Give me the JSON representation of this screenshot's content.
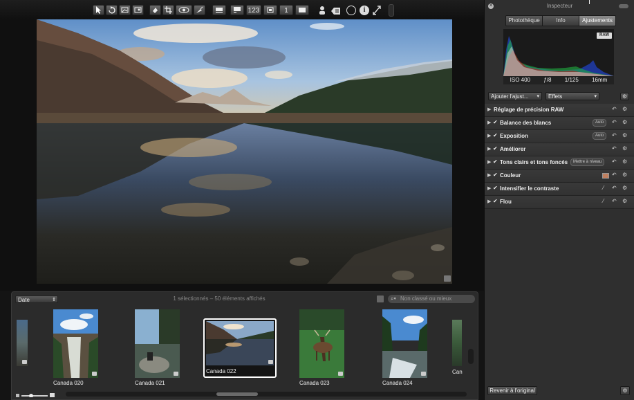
{
  "toolbar": {
    "tools": [
      {
        "icon": "pointer-icon"
      },
      {
        "icon": "rotate-icon"
      },
      {
        "icon": "straighten-icon"
      },
      {
        "icon": "crop-overlay-icon"
      },
      {
        "icon": "lift-icon"
      },
      {
        "icon": "crop-icon"
      },
      {
        "icon": "redeye-icon"
      },
      {
        "icon": "brush-icon"
      }
    ],
    "views": [
      {
        "icon": "filmstrip-view-icon"
      },
      {
        "icon": "split-view-icon"
      },
      {
        "icon": "grid-view-icon"
      },
      {
        "icon": "viewer-icon"
      },
      {
        "icon": "compare-icon"
      },
      {
        "icon": "fullscreen-icon"
      }
    ],
    "view_labels": [
      "",
      "",
      "123",
      "",
      "1",
      ""
    ],
    "right_icons": [
      "person-icon",
      "tag-icon",
      "circle-icon",
      "info-icon",
      "expand-icon",
      "toggle-icon"
    ]
  },
  "browser": {
    "sort_value": "Date",
    "status": "1 sélectionnés – 50 éléments affichés",
    "filter_placeholder": "Non classé ou mieux",
    "thumbs": [
      {
        "caption": "",
        "selected": false,
        "scene": "partial-left"
      },
      {
        "caption": "Canada 020",
        "selected": false,
        "scene": "waterfall"
      },
      {
        "caption": "Canada 021",
        "selected": false,
        "scene": "rocks"
      },
      {
        "caption": "Canada 022",
        "selected": true,
        "scene": "lake"
      },
      {
        "caption": "Canada 023",
        "selected": false,
        "scene": "elk"
      },
      {
        "caption": "Canada 024",
        "selected": false,
        "scene": "stream"
      },
      {
        "caption": "Can",
        "selected": false,
        "scene": "partial-right"
      }
    ]
  },
  "inspector": {
    "title": "Inspecteur",
    "tabs": [
      "Photothèque",
      "Info",
      "Ajustements"
    ],
    "active_tab": "Ajustements",
    "raw_badge": "RAW",
    "exif": [
      "ISO 400",
      "ƒ/8",
      "1/125",
      "16mm"
    ],
    "add_adjustment": "Ajouter l'ajust...",
    "effects": "Effets",
    "adjustments": [
      {
        "label": "Réglage de précision RAW",
        "checked": false,
        "pill": "",
        "tool": ""
      },
      {
        "label": "Balance des blancs",
        "checked": true,
        "pill": "Auto",
        "tool": ""
      },
      {
        "label": "Exposition",
        "checked": true,
        "pill": "Auto",
        "tool": ""
      },
      {
        "label": "Améliorer",
        "checked": true,
        "pill": "",
        "tool": ""
      },
      {
        "label": "Tons clairs et tons foncés",
        "checked": true,
        "pill": "Mettre à niveau",
        "tool": ""
      },
      {
        "label": "Couleur",
        "checked": true,
        "pill": "",
        "tool": "swatch"
      },
      {
        "label": "Intensifier le contraste",
        "checked": true,
        "pill": "",
        "tool": "brush"
      },
      {
        "label": "Flou",
        "checked": true,
        "pill": "",
        "tool": "brush"
      }
    ],
    "revert_label": "Revenir à l'original",
    "colors": {
      "active_tab": "#7a7a7a",
      "panel": "#2f2f2f",
      "selection_border": "#ffffff"
    }
  }
}
